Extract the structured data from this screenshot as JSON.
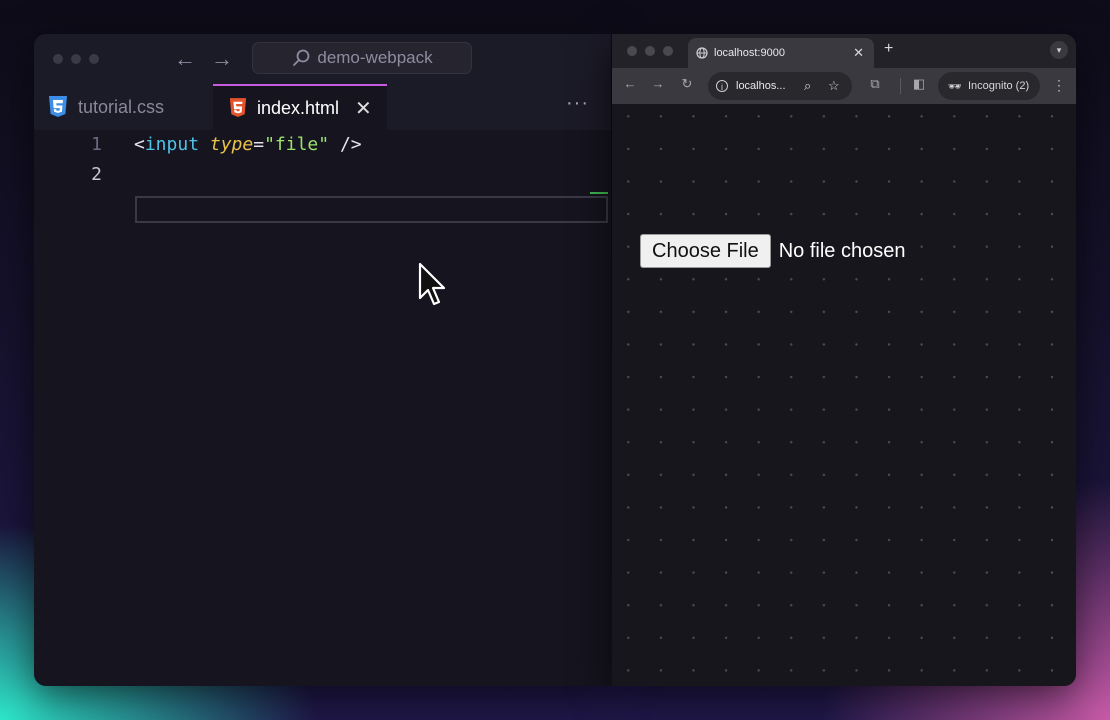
{
  "editor": {
    "search_label": "demo-webpack",
    "tabs": [
      {
        "label": "tutorial.css",
        "icon": "css3-icon"
      },
      {
        "label": "index.html",
        "icon": "html5-icon",
        "active": true
      }
    ],
    "more_label": "···",
    "lines": [
      {
        "number": "1",
        "code": {
          "open": "<",
          "tag": "input",
          "attr": "type",
          "eq": "=",
          "value": "\"file\"",
          "close": " />"
        }
      },
      {
        "number": "2",
        "code": null
      }
    ],
    "colors": {
      "tag": "#4fc3e6",
      "attr": "#e8c34a",
      "string": "#9be26b",
      "active_tab_border": "#c45be0"
    }
  },
  "browser": {
    "tab_title": "localhost:9000",
    "address": "localhos...",
    "incognito_label": "Incognito (2)",
    "page": {
      "file_button_label": "Choose File",
      "file_status": "No file chosen"
    }
  }
}
